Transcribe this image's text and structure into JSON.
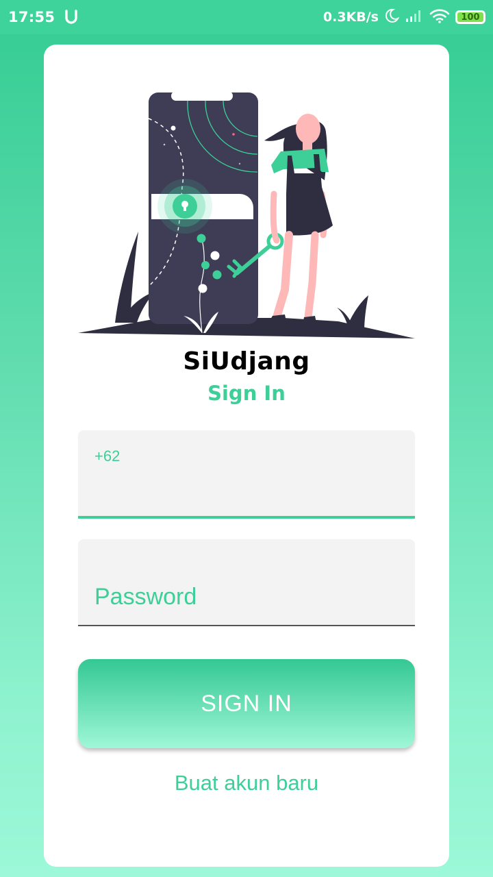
{
  "status_bar": {
    "time": "17:55",
    "carrier_icon": "u-icon",
    "network_speed": "0.3KB/s",
    "battery_level": "100",
    "icons": [
      "moon-icon",
      "signal-icon",
      "wifi-icon",
      "battery-icon"
    ]
  },
  "app": {
    "title": "SiUdjang",
    "subtitle": "Sign In"
  },
  "form": {
    "phone_prefix": "+62",
    "phone_value": "",
    "password_placeholder": "Password",
    "sign_in_label": "SIGN IN",
    "create_account_label": "Buat akun baru"
  },
  "colors": {
    "accent": "#3ecf98",
    "background_top": "#34cc93",
    "background_bottom": "#9cf8d8",
    "illustration_dark": "#3f3d56",
    "skin": "#ffb8b8"
  }
}
